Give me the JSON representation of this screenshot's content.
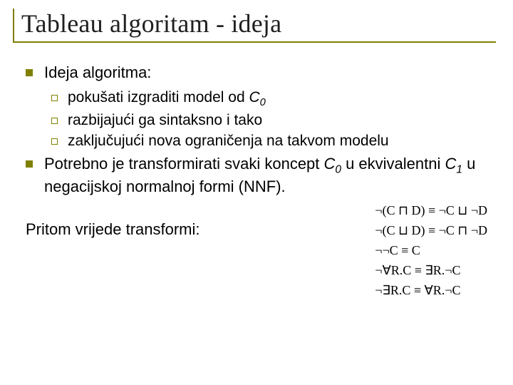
{
  "title": "Tableau algoritam - ideja",
  "bullets": {
    "lead": "Ideja algoritma:",
    "sub": [
      "pokušati izgraditi model od C₀",
      "razbijajući ga sintaksno i tako",
      "zaključujući nova ograničenja na takvom modelu"
    ],
    "para1": "Potrebno je transformirati svaki koncept C₀ u ekvivalentni C₁ u negacijskoj normalnoj formi (NNF).",
    "para2": "Pritom vrijede transformi:"
  },
  "formulae": [
    "¬(C ⊓ D) ≡ ¬C ⊔ ¬D",
    "¬(C ⊔ D) ≡ ¬C ⊓ ¬D",
    "¬¬C ≡ C",
    "¬∀R.C ≡ ∃R.¬C",
    "¬∃R.C ≡ ∀R.¬C"
  ]
}
